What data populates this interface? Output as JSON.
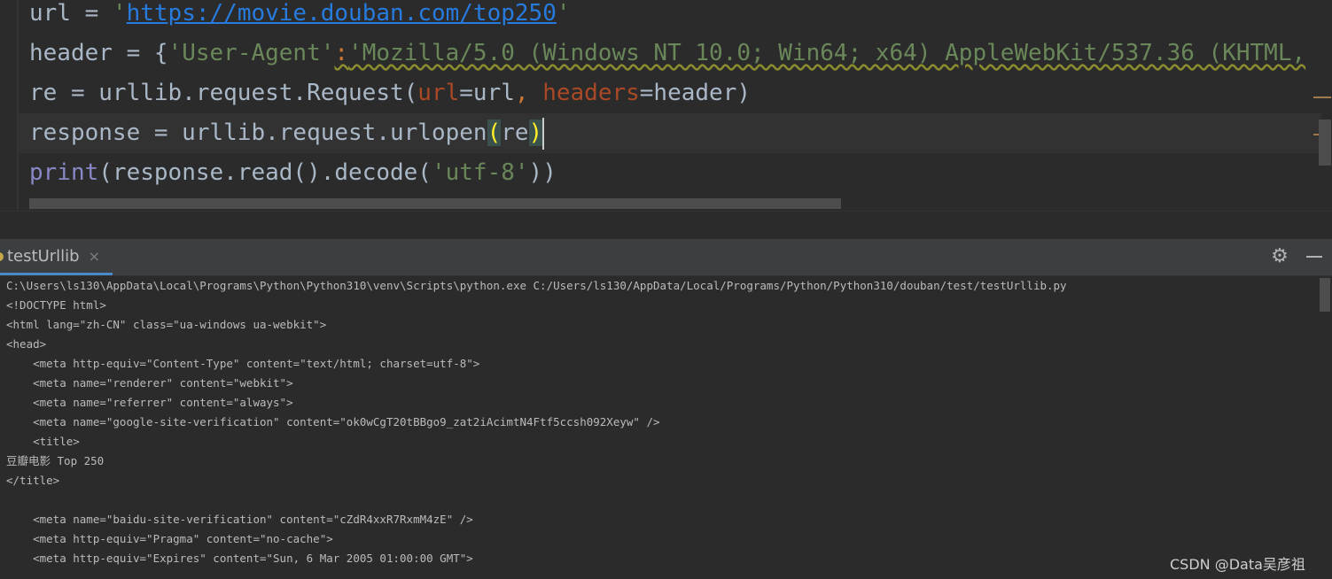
{
  "editor": {
    "line1": {
      "var": "url",
      "op": " = ",
      "q1": "'",
      "url": "https://movie.douban.com/top250",
      "q2": "'"
    },
    "line2": {
      "var": "header",
      "op": " = {",
      "key": "'User-Agent'",
      "colon": ":",
      "value": "'Mozilla/5.0 (Windows NT 10.0; Win64; x64) AppleWebKit/537.36 (KHTML,"
    },
    "line3": {
      "lhs": "re = urllib.request.Request(",
      "p1": "url",
      "eq1": "=url",
      "comma": ", ",
      "p2": "headers",
      "eq2": "=header)"
    },
    "line4": {
      "lhs": "response = urllib.request.urlopen",
      "open": "(",
      "arg": "re",
      "close": ")"
    },
    "line5": {
      "fn": "print",
      "mid": "(response.read().decode(",
      "str": "'utf-8'",
      "end": "))"
    }
  },
  "run": {
    "tab_label": "testUrllib",
    "tab_close": "×",
    "gear": "⚙"
  },
  "console": {
    "lines": [
      "C:\\Users\\ls130\\AppData\\Local\\Programs\\Python\\Python310\\venv\\Scripts\\python.exe C:/Users/ls130/AppData/Local/Programs/Python/Python310/douban/test/testUrllib.py",
      "<!DOCTYPE html>",
      "<html lang=\"zh-CN\" class=\"ua-windows ua-webkit\">",
      "<head>",
      "    <meta http-equiv=\"Content-Type\" content=\"text/html; charset=utf-8\">",
      "    <meta name=\"renderer\" content=\"webkit\">",
      "    <meta name=\"referrer\" content=\"always\">",
      "    <meta name=\"google-site-verification\" content=\"ok0wCgT20tBBgo9_zat2iAcimtN4Ftf5ccsh092Xeyw\" />",
      "    <title>",
      "豆瓣电影 Top 250",
      "</title>",
      "",
      "    <meta name=\"baidu-site-verification\" content=\"cZdR4xxR7RxmM4zE\" />",
      "    <meta http-equiv=\"Pragma\" content=\"no-cache\">",
      "    <meta http-equiv=\"Expires\" content=\"Sun, 6 Mar 2005 01:00:00 GMT\">"
    ]
  },
  "watermark": "CSDN @Data吴彦祖"
}
